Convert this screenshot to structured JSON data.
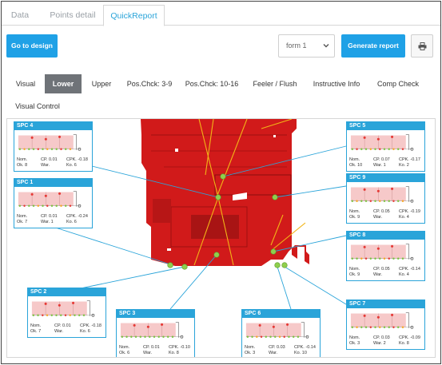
{
  "tabs": [
    {
      "label": "Data"
    },
    {
      "label": "Points detail"
    },
    {
      "label": "QuickReport"
    }
  ],
  "actions": {
    "go_to_design": "Go to design",
    "form_select": "form 1",
    "generate_report": "Generate report",
    "print_icon": "printer-icon"
  },
  "subtabs": [
    {
      "label": "Visual"
    },
    {
      "label": "Lower"
    },
    {
      "label": "Upper"
    },
    {
      "label": "Pos.Chck: 3-9"
    },
    {
      "label": "Pos.Chck: 10-16"
    },
    {
      "label": "Feeler / Flush"
    },
    {
      "label": "Instructive Info"
    },
    {
      "label": "Comp Check"
    },
    {
      "label": "Visual Control"
    }
  ],
  "colors": {
    "accent": "#1fa1e6",
    "card_border": "#2aa4d9",
    "part_red": "#d11a1a",
    "ok_green": "#7cc242",
    "nok_red": "#e53935",
    "warn_orange": "#f5a623",
    "tolerance_band": "#f6c9c9"
  },
  "spc": [
    {
      "title": "SPC 4",
      "nom": "Nom.",
      "ok": "Ok. 8",
      "cp": "CP. 0.01",
      "war": "War.",
      "cpk": "CPK. -0.18",
      "ko": "Ko. 6"
    },
    {
      "title": "SPC 1",
      "nom": "Nom.",
      "ok": "Ok. 7",
      "cp": "CP. 0.01",
      "war": "War. 1",
      "cpk": "CPK. -0.24",
      "ko": "Ko. 6"
    },
    {
      "title": "SPC 2",
      "nom": "Nom.",
      "ok": "Ok. 7",
      "cp": "CP. 0.01",
      "war": "War.",
      "cpk": "CPK. -0.18",
      "ko": "Ko. 6"
    },
    {
      "title": "SPC 3",
      "nom": "Nom.",
      "ok": "Ok. 6",
      "cp": "CP. 0.01",
      "war": "War.",
      "cpk": "CPK. -0.10",
      "ko": "Ko. 8"
    },
    {
      "title": "SPC 6",
      "nom": "Nom.",
      "ok": "Ok. 3",
      "cp": "CP. 0.03",
      "war": "War.",
      "cpk": "CPK. -0.14",
      "ko": "Ko. 10"
    },
    {
      "title": "SPC 5",
      "nom": "Nom.",
      "ok": "Ok. 10",
      "cp": "CP. 0.07",
      "war": "War. 1",
      "cpk": "CPK. -0.17",
      "ko": "Ko. 2"
    },
    {
      "title": "SPC 9",
      "nom": "Nom.",
      "ok": "Ok. 9",
      "cp": "CP. 0.05",
      "war": "War.",
      "cpk": "CPK. -0.19",
      "ko": "Ko. 4"
    },
    {
      "title": "SPC 8",
      "nom": "Nom.",
      "ok": "Ok. 9",
      "cp": "CP. 0.05",
      "war": "War.",
      "cpk": "CPK. -0.14",
      "ko": "Ko. 4"
    },
    {
      "title": "SPC 7",
      "nom": "Nom.",
      "ok": "Ok. 3",
      "cp": "CP. 0.03",
      "war": "War. 2",
      "cpk": "CPK. -0.09",
      "ko": "Ko. 8"
    }
  ]
}
